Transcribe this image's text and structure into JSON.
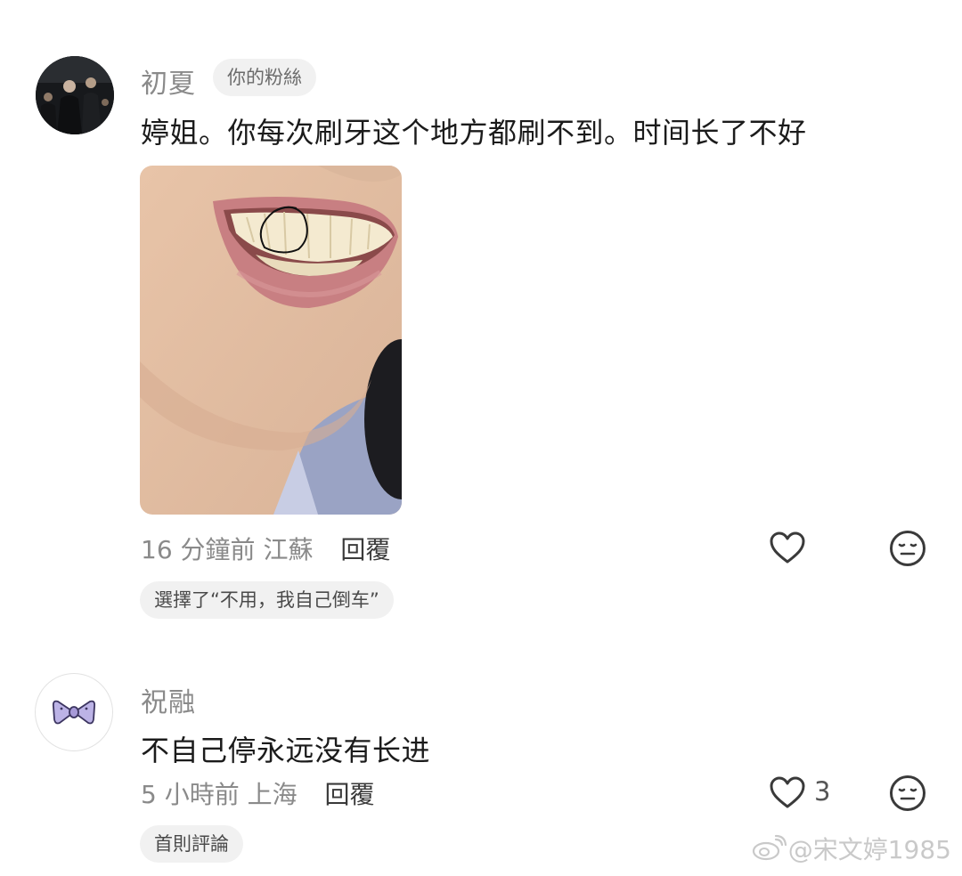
{
  "comments": [
    {
      "username": "初夏",
      "badge": "你的粉絲",
      "text": "婷姐。你每次刷牙这个地方都刷不到。时间长了不好",
      "time": "16 分鐘前",
      "location": "江蘇",
      "reply_label": "回覆",
      "choice_tag": "選擇了“不用，我自己倒车”",
      "avatar_icon": "avatar-photo-icon"
    },
    {
      "username": "祝融",
      "text": "不自己停永远没有长进",
      "time": "5 小時前",
      "location": "上海",
      "reply_label": "回覆",
      "like_count": "3",
      "tag": "首則評論",
      "avatar_icon": "bow-icon"
    }
  ],
  "watermark": "@宋文婷1985",
  "colors": {
    "meta_gray": "#8a8a8a",
    "pill_bg": "#f1f1f1",
    "icon_gray": "#3a3a3a",
    "bow_purple": "#bcb3e6"
  }
}
